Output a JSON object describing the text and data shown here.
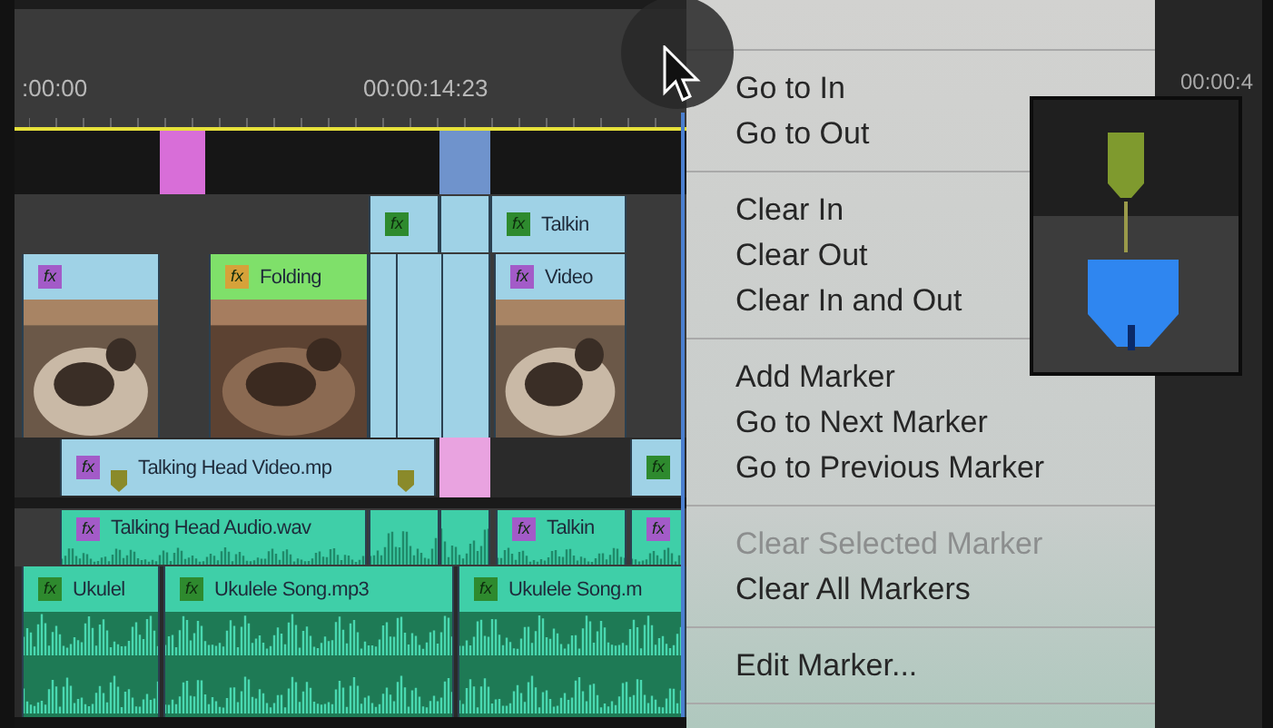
{
  "ruler": {
    "timecodes": [
      ":00:00",
      "00:00:14:23"
    ]
  },
  "tracks": [
    {
      "kind": "markers",
      "clips": [
        {
          "kind": "block",
          "color": "#d86ed8"
        },
        {
          "kind": "block",
          "color": "#6f93cc"
        }
      ]
    },
    {
      "kind": "video",
      "clips": [
        {
          "kind": "clip",
          "badge": "fx",
          "color": "#2e8a2e"
        },
        {
          "kind": "clip"
        },
        {
          "kind": "clip",
          "badge": "fx",
          "color": "#2e8a2e",
          "label": "Talkin"
        }
      ]
    },
    {
      "kind": "video",
      "clips": [
        {
          "kind": "clip_thumb",
          "badge": "fx",
          "color": "#a35bc8"
        },
        {
          "kind": "clip_highlight",
          "badge": "fx",
          "color": "#d6a23a",
          "label": "Folding"
        },
        {
          "kind": "clip_split"
        },
        {
          "kind": "clip_thumb",
          "badge": "fx",
          "color": "#a35bc8",
          "label": "Video"
        }
      ]
    },
    {
      "kind": "video",
      "clips": [
        {
          "kind": "clip",
          "badge": "fx",
          "color": "#a35bc8",
          "label": "Talking Head Video.mp"
        },
        {
          "kind": "block",
          "color": "#e9a3e0"
        },
        {
          "kind": "clip",
          "badge": "fx",
          "color": "#2e8a2e"
        }
      ]
    },
    {
      "kind": "audio",
      "clips": [
        {
          "kind": "audio",
          "badge": "fx",
          "color": "#a35bc8",
          "label": "Talking Head Audio.wav"
        },
        {
          "kind": "audio"
        },
        {
          "kind": "audio"
        },
        {
          "kind": "audio",
          "badge": "fx",
          "color": "#a35bc8",
          "label": "Talkin"
        },
        {
          "kind": "audio",
          "badge": "fx",
          "color": "#a35bc8"
        }
      ]
    },
    {
      "kind": "music",
      "clips": [
        {
          "kind": "music",
          "badge": "fx",
          "color": "#2e8a2e",
          "label": "Ukulel"
        },
        {
          "kind": "music",
          "badge": "fx",
          "color": "#2e8a2e",
          "label": "Ukulele Song.mp3"
        },
        {
          "kind": "music",
          "badge": "fx",
          "color": "#2e8a2e",
          "label": "Ukulele Song.m"
        }
      ]
    }
  ],
  "menu": {
    "groups": [
      {
        "items": [
          {
            "label": "Go to In",
            "disabled": false
          },
          {
            "label": "Go to Out",
            "disabled": false
          }
        ]
      },
      {
        "items": [
          {
            "label": "Clear In",
            "disabled": false
          },
          {
            "label": "Clear Out",
            "disabled": false
          },
          {
            "label": "Clear In and Out",
            "disabled": false
          }
        ]
      },
      {
        "items": [
          {
            "label": "Add Marker",
            "disabled": false
          },
          {
            "label": "Go to Next Marker",
            "disabled": false
          },
          {
            "label": "Go to Previous Marker",
            "disabled": false
          }
        ]
      },
      {
        "items": [
          {
            "label": "Clear Selected Marker",
            "disabled": true
          },
          {
            "label": "Clear All Markers",
            "disabled": false
          }
        ]
      },
      {
        "items": [
          {
            "label": "Edit Marker...",
            "disabled": false
          }
        ]
      }
    ]
  },
  "side_panel": {
    "timecode": "00:00:4"
  }
}
